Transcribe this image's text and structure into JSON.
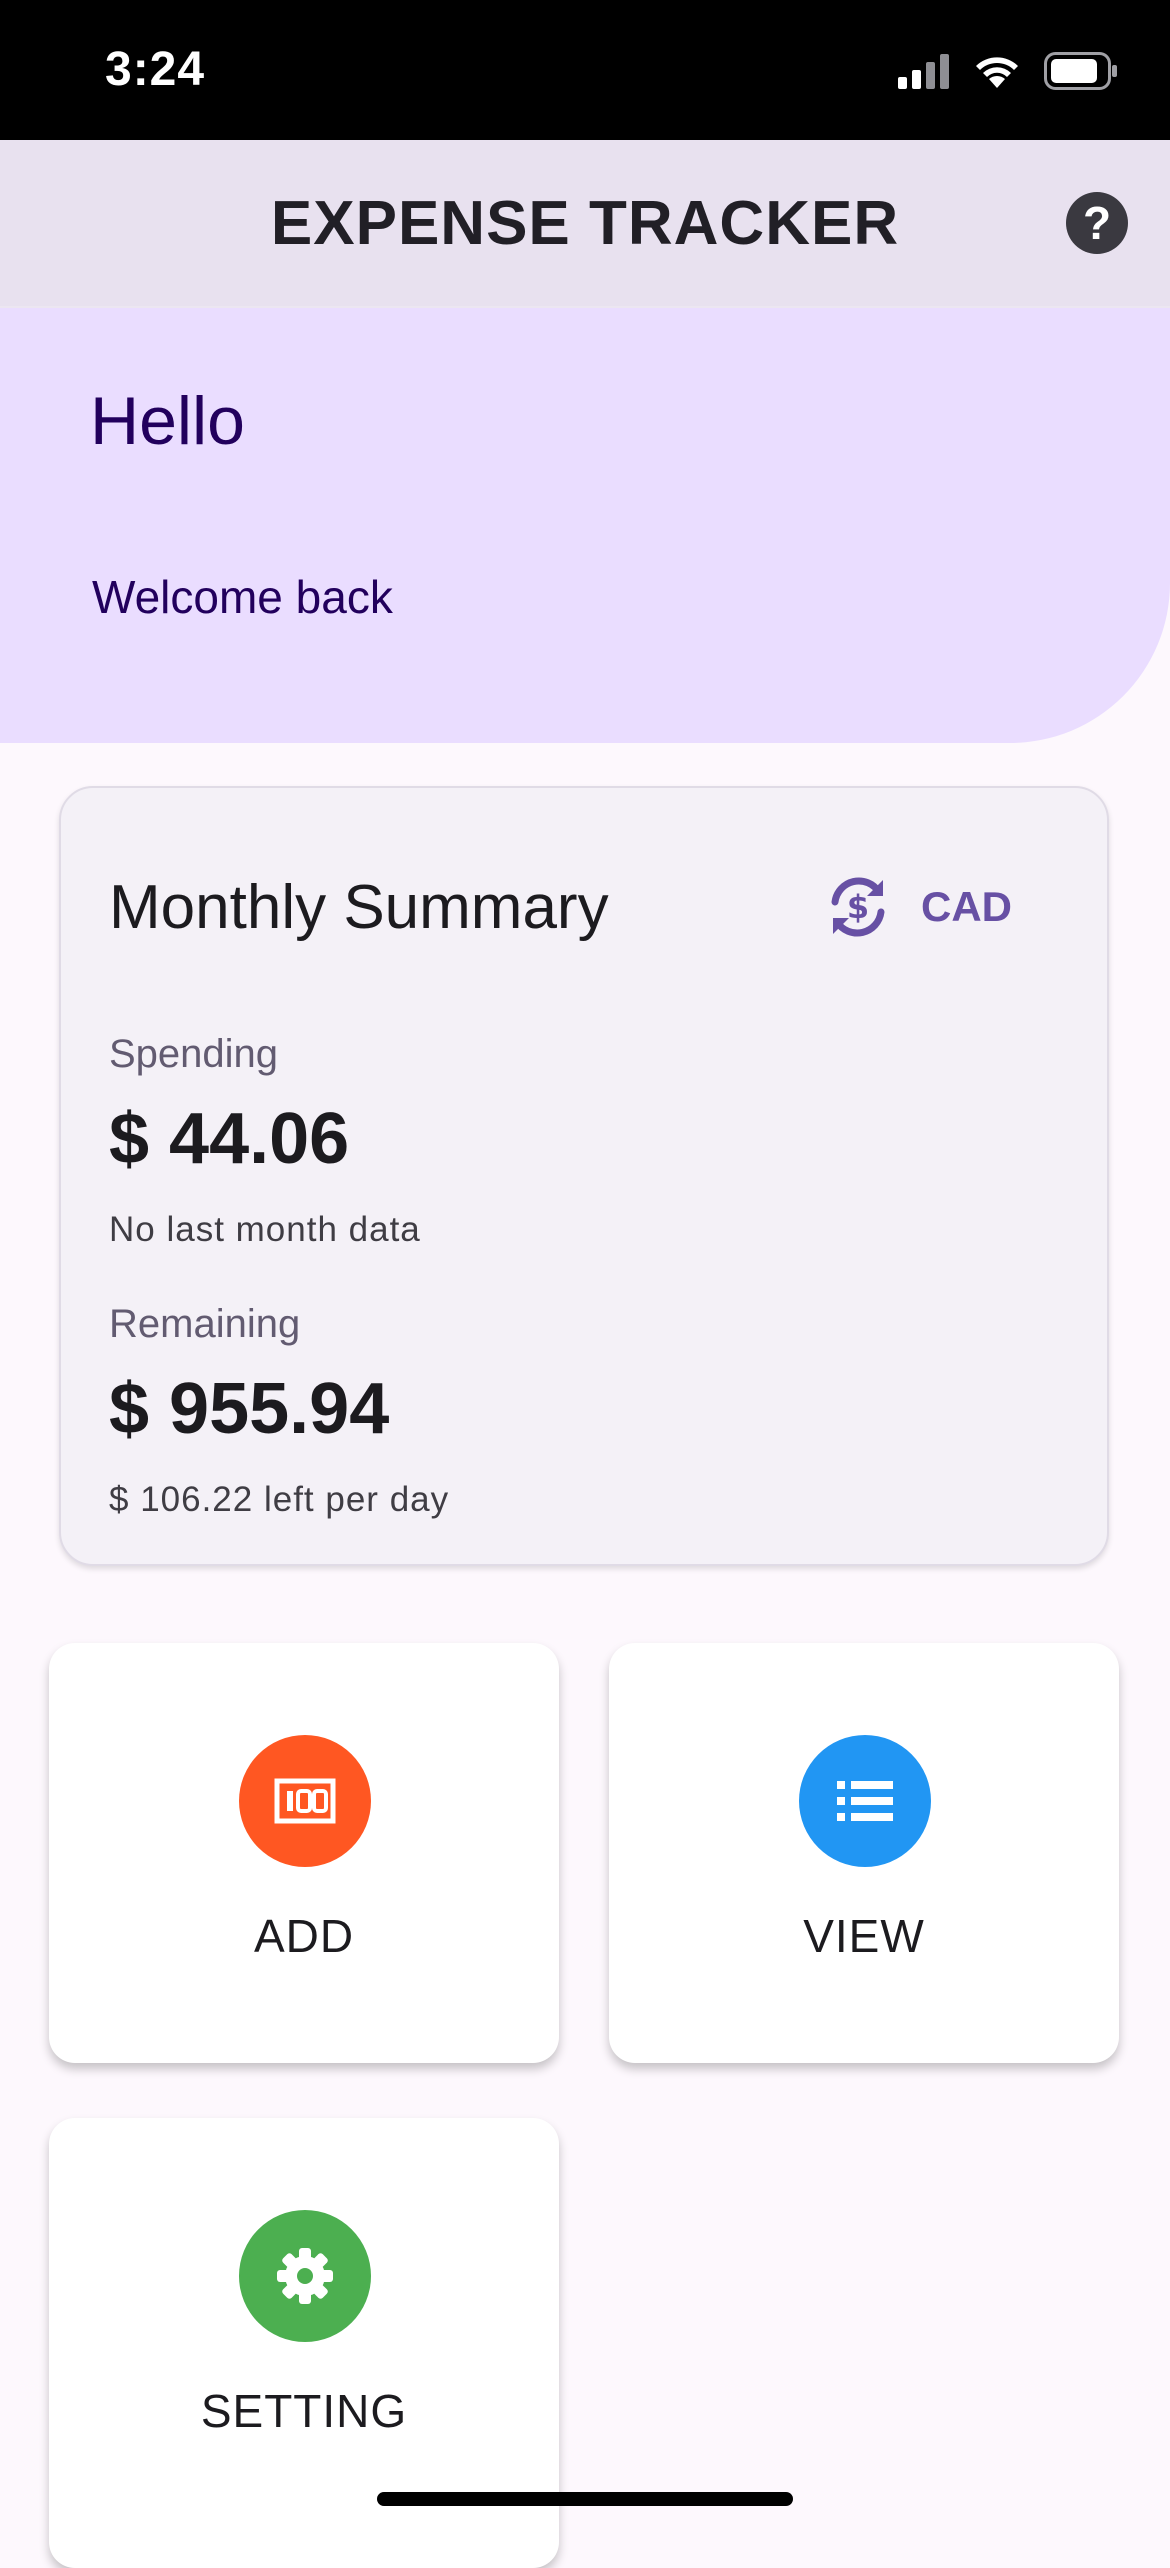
{
  "status_bar": {
    "time": "3:24",
    "icons": [
      "cellular-signal-icon",
      "wifi-icon",
      "battery-icon"
    ]
  },
  "app_bar": {
    "title": "EXPENSE TRACKER",
    "help_icon": "help-circle-icon",
    "help_glyph": "?"
  },
  "greeting": {
    "hello": "Hello",
    "welcome": "Welcome back"
  },
  "summary": {
    "title": "Monthly Summary",
    "currency_icon": "currency-exchange-icon",
    "currency": "CAD",
    "spending_label": "Spending",
    "spending_amount": "$ 44.06",
    "spending_note": "No last month data",
    "remaining_label": "Remaining",
    "remaining_amount": "$ 955.94",
    "remaining_note": "$ 106.22 left per day"
  },
  "tiles": [
    {
      "label": "ADD",
      "icon": "money-icon",
      "color": "#ff5722"
    },
    {
      "label": "VIEW",
      "icon": "list-icon",
      "color": "#2196f3"
    },
    {
      "label": "SETTING",
      "icon": "gear-icon",
      "color": "#4caf50"
    }
  ],
  "colors": {
    "app_bar": "#e8e1ef",
    "hero": "#eaddff",
    "accent": "#6750a4",
    "background": "#fdf8fd"
  }
}
